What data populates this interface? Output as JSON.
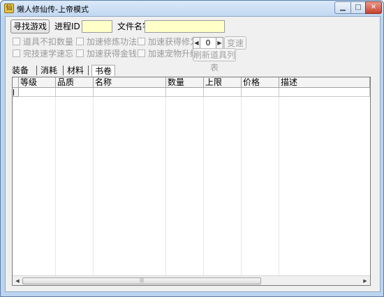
{
  "window": {
    "title": "懒人修仙传-上帝模式",
    "app_icon_glyph": "仙",
    "minimize_glyph": "▁",
    "maximize_glyph": "□",
    "close_glyph": "✕"
  },
  "toolbar": {
    "find_game_label": "寻找游戏",
    "process_id_label": "进程ID",
    "process_id_value": "",
    "file_name_label": "文件名字",
    "file_name_value": ""
  },
  "options": {
    "item_no_deduct": "道具不扣数量",
    "speed_cultivation": "加速修炼功法",
    "speed_gain_cultivation": "加速获得修为",
    "skill_quick_learn": "完技速学速忘",
    "speed_gain_money": "加速获得金钱",
    "speed_pet_upgrade": "加速宠物升级"
  },
  "spinner": {
    "value": "0",
    "left_arrow": "◀",
    "right_arrow": "▶"
  },
  "buttons": {
    "change_speed": "变速",
    "refresh_items": "刷新道具列表"
  },
  "tabs": [
    "装备",
    "消耗",
    "材料",
    "书卷"
  ],
  "active_tab": "书卷",
  "table": {
    "columns": [
      "等级",
      "品质",
      "名称",
      "数量",
      "上限",
      "价格",
      "描述"
    ]
  },
  "scrollbar": {
    "left_arrow": "◀",
    "right_arrow": "▶",
    "grip": "|||"
  },
  "colors": {
    "titlebar": "#c2d8f1",
    "input_bg": "#ffffc8",
    "close_button": "#c5432f",
    "disabled_text": "#9a9a9a"
  }
}
